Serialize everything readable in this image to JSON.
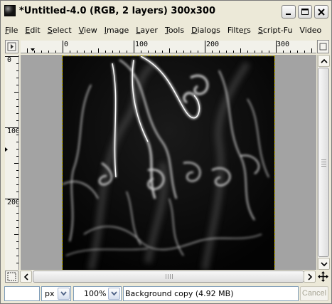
{
  "window": {
    "title": "*Untitled-4.0 (RGB, 2 layers) 300x300"
  },
  "menu": [
    {
      "label": "File",
      "key": "F",
      "rest": "ile"
    },
    {
      "label": "Edit",
      "key": "E",
      "rest": "dit"
    },
    {
      "label": "Select",
      "key": "S",
      "rest": "elect"
    },
    {
      "label": "View",
      "key": "V",
      "rest": "iew"
    },
    {
      "label": "Image",
      "key": "I",
      "rest": "mage"
    },
    {
      "label": "Layer",
      "key": "L",
      "rest": "ayer"
    },
    {
      "label": "Tools",
      "key": "T",
      "rest": "ools"
    },
    {
      "label": "Dialogs",
      "key": "D",
      "rest": "ialogs"
    },
    {
      "label": "Filters",
      "key": "r",
      "pre": "Filte",
      "rest": "s"
    },
    {
      "label": "Script-Fu",
      "key": "S",
      "rest": "cript-Fu"
    },
    {
      "label": "Video",
      "key": "",
      "rest": "Video"
    }
  ],
  "rulers": {
    "horizontal_labels": [
      "0",
      "100",
      "200",
      "300"
    ],
    "vertical_labels": [
      "0",
      "100",
      "200"
    ]
  },
  "statusbar": {
    "unit": "px",
    "zoom": "100%",
    "message": "Background copy (4.92 MB)",
    "cancel_label": "Cancel"
  },
  "icons": {
    "app": "gimp-image-icon",
    "minimize": "minimize-icon",
    "maximize": "maximize-icon",
    "close": "close-icon"
  }
}
